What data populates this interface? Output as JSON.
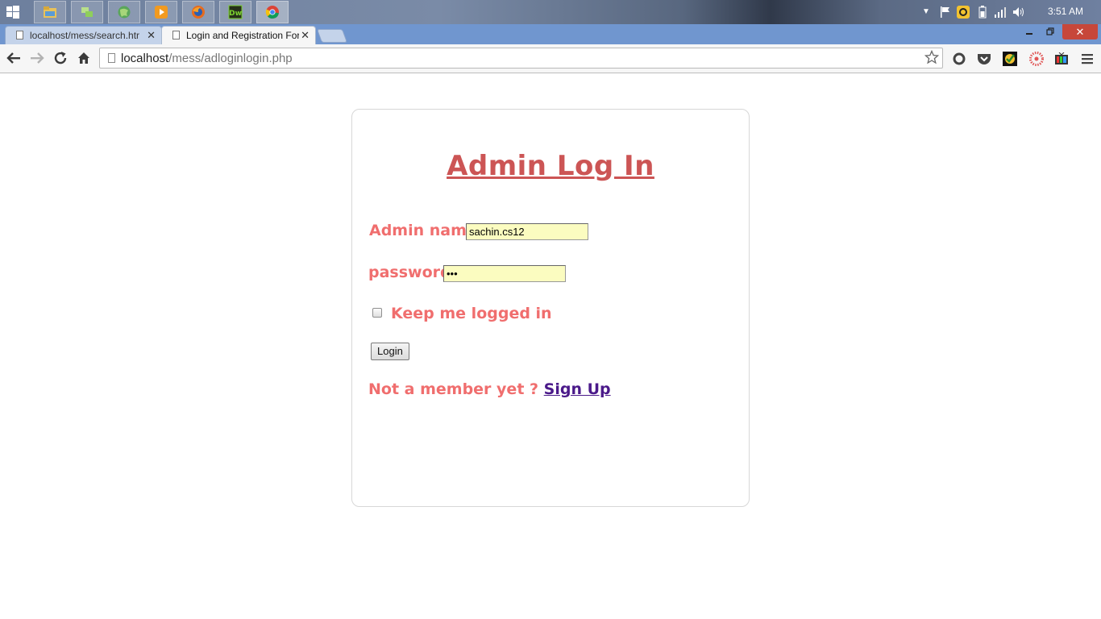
{
  "taskbar": {
    "apps": [
      {
        "icon": "file-explorer-icon",
        "active": false
      },
      {
        "icon": "network-icon",
        "active": false
      },
      {
        "icon": "globe-icon",
        "active": false
      },
      {
        "icon": "media-player-icon",
        "active": false
      },
      {
        "icon": "firefox-icon",
        "active": false
      },
      {
        "icon": "dreamweaver-icon",
        "label": "Dw",
        "active": false
      },
      {
        "icon": "chrome-icon",
        "active": true
      }
    ],
    "clock": "3:51 AM"
  },
  "browser": {
    "tabs": [
      {
        "title": "localhost/mess/search.htr",
        "active": false
      },
      {
        "title": "Login and Registration For",
        "active": true
      }
    ],
    "close_glyph": "✕",
    "url_host": "localhost",
    "url_path": "/mess/adloginlogin.php"
  },
  "form": {
    "title": "Admin Log In",
    "admin_name_label": "Admin name",
    "admin_name_value": "sachin.cs12",
    "password_label": "password",
    "password_value": "abc",
    "remember_label": "Keep me logged in",
    "remember_checked": false,
    "login_button": "Login",
    "signup_prompt": "Not a member yet ?",
    "signup_link": "Sign Up"
  },
  "colors": {
    "title": "#cc5555",
    "label": "#f06e6e",
    "input_bg": "#fbfcc0",
    "link": "#4b1a8a",
    "tabstrip": "#7096cf"
  }
}
